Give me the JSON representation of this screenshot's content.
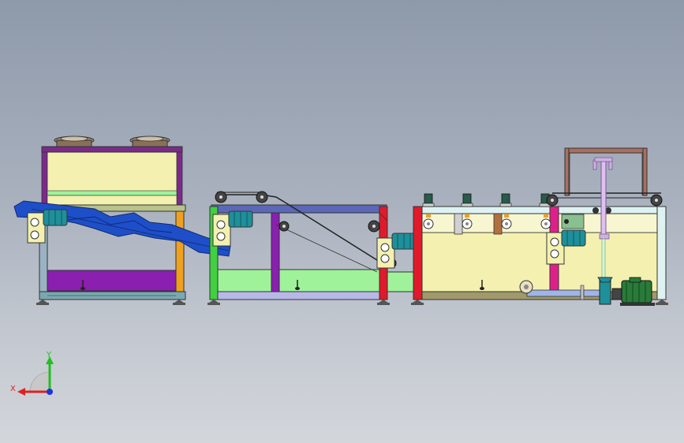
{
  "colors": {
    "frame_purple": "#7a2a8a",
    "panel_yellow": "#f4f1b0",
    "frame_blue": "#5b68b8",
    "tank_green": "#9ff29a",
    "trough_purple": "#8a1fb0",
    "motor_teal": "#1f8f9a",
    "conveyor_blue": "#1e4fc8",
    "red_post": "#e01a2a",
    "magenta_post": "#e0208a",
    "orange_post": "#f0a020",
    "pipe_blue": "#9fb5e8",
    "motor_dark": "#2a7a3a"
  },
  "triad": {
    "x_label": "X",
    "y_label": "Y",
    "x_color": "#e02020",
    "y_color": "#20c020",
    "z_color": "#2030e0"
  }
}
